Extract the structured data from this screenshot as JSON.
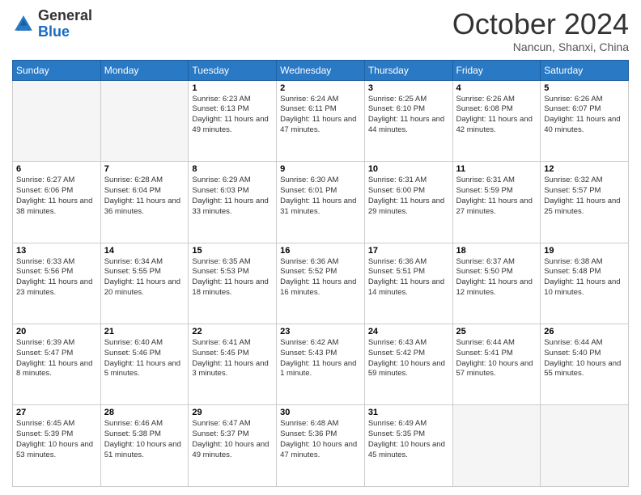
{
  "logo": {
    "general": "General",
    "blue": "Blue"
  },
  "header": {
    "month": "October 2024",
    "location": "Nancun, Shanxi, China"
  },
  "weekdays": [
    "Sunday",
    "Monday",
    "Tuesday",
    "Wednesday",
    "Thursday",
    "Friday",
    "Saturday"
  ],
  "weeks": [
    [
      {
        "day": "",
        "sunrise": "",
        "sunset": "",
        "daylight": ""
      },
      {
        "day": "",
        "sunrise": "",
        "sunset": "",
        "daylight": ""
      },
      {
        "day": "1",
        "sunrise": "Sunrise: 6:23 AM",
        "sunset": "Sunset: 6:13 PM",
        "daylight": "Daylight: 11 hours and 49 minutes."
      },
      {
        "day": "2",
        "sunrise": "Sunrise: 6:24 AM",
        "sunset": "Sunset: 6:11 PM",
        "daylight": "Daylight: 11 hours and 47 minutes."
      },
      {
        "day": "3",
        "sunrise": "Sunrise: 6:25 AM",
        "sunset": "Sunset: 6:10 PM",
        "daylight": "Daylight: 11 hours and 44 minutes."
      },
      {
        "day": "4",
        "sunrise": "Sunrise: 6:26 AM",
        "sunset": "Sunset: 6:08 PM",
        "daylight": "Daylight: 11 hours and 42 minutes."
      },
      {
        "day": "5",
        "sunrise": "Sunrise: 6:26 AM",
        "sunset": "Sunset: 6:07 PM",
        "daylight": "Daylight: 11 hours and 40 minutes."
      }
    ],
    [
      {
        "day": "6",
        "sunrise": "Sunrise: 6:27 AM",
        "sunset": "Sunset: 6:06 PM",
        "daylight": "Daylight: 11 hours and 38 minutes."
      },
      {
        "day": "7",
        "sunrise": "Sunrise: 6:28 AM",
        "sunset": "Sunset: 6:04 PM",
        "daylight": "Daylight: 11 hours and 36 minutes."
      },
      {
        "day": "8",
        "sunrise": "Sunrise: 6:29 AM",
        "sunset": "Sunset: 6:03 PM",
        "daylight": "Daylight: 11 hours and 33 minutes."
      },
      {
        "day": "9",
        "sunrise": "Sunrise: 6:30 AM",
        "sunset": "Sunset: 6:01 PM",
        "daylight": "Daylight: 11 hours and 31 minutes."
      },
      {
        "day": "10",
        "sunrise": "Sunrise: 6:31 AM",
        "sunset": "Sunset: 6:00 PM",
        "daylight": "Daylight: 11 hours and 29 minutes."
      },
      {
        "day": "11",
        "sunrise": "Sunrise: 6:31 AM",
        "sunset": "Sunset: 5:59 PM",
        "daylight": "Daylight: 11 hours and 27 minutes."
      },
      {
        "day": "12",
        "sunrise": "Sunrise: 6:32 AM",
        "sunset": "Sunset: 5:57 PM",
        "daylight": "Daylight: 11 hours and 25 minutes."
      }
    ],
    [
      {
        "day": "13",
        "sunrise": "Sunrise: 6:33 AM",
        "sunset": "Sunset: 5:56 PM",
        "daylight": "Daylight: 11 hours and 23 minutes."
      },
      {
        "day": "14",
        "sunrise": "Sunrise: 6:34 AM",
        "sunset": "Sunset: 5:55 PM",
        "daylight": "Daylight: 11 hours and 20 minutes."
      },
      {
        "day": "15",
        "sunrise": "Sunrise: 6:35 AM",
        "sunset": "Sunset: 5:53 PM",
        "daylight": "Daylight: 11 hours and 18 minutes."
      },
      {
        "day": "16",
        "sunrise": "Sunrise: 6:36 AM",
        "sunset": "Sunset: 5:52 PM",
        "daylight": "Daylight: 11 hours and 16 minutes."
      },
      {
        "day": "17",
        "sunrise": "Sunrise: 6:36 AM",
        "sunset": "Sunset: 5:51 PM",
        "daylight": "Daylight: 11 hours and 14 minutes."
      },
      {
        "day": "18",
        "sunrise": "Sunrise: 6:37 AM",
        "sunset": "Sunset: 5:50 PM",
        "daylight": "Daylight: 11 hours and 12 minutes."
      },
      {
        "day": "19",
        "sunrise": "Sunrise: 6:38 AM",
        "sunset": "Sunset: 5:48 PM",
        "daylight": "Daylight: 11 hours and 10 minutes."
      }
    ],
    [
      {
        "day": "20",
        "sunrise": "Sunrise: 6:39 AM",
        "sunset": "Sunset: 5:47 PM",
        "daylight": "Daylight: 11 hours and 8 minutes."
      },
      {
        "day": "21",
        "sunrise": "Sunrise: 6:40 AM",
        "sunset": "Sunset: 5:46 PM",
        "daylight": "Daylight: 11 hours and 5 minutes."
      },
      {
        "day": "22",
        "sunrise": "Sunrise: 6:41 AM",
        "sunset": "Sunset: 5:45 PM",
        "daylight": "Daylight: 11 hours and 3 minutes."
      },
      {
        "day": "23",
        "sunrise": "Sunrise: 6:42 AM",
        "sunset": "Sunset: 5:43 PM",
        "daylight": "Daylight: 11 hours and 1 minute."
      },
      {
        "day": "24",
        "sunrise": "Sunrise: 6:43 AM",
        "sunset": "Sunset: 5:42 PM",
        "daylight": "Daylight: 10 hours and 59 minutes."
      },
      {
        "day": "25",
        "sunrise": "Sunrise: 6:44 AM",
        "sunset": "Sunset: 5:41 PM",
        "daylight": "Daylight: 10 hours and 57 minutes."
      },
      {
        "day": "26",
        "sunrise": "Sunrise: 6:44 AM",
        "sunset": "Sunset: 5:40 PM",
        "daylight": "Daylight: 10 hours and 55 minutes."
      }
    ],
    [
      {
        "day": "27",
        "sunrise": "Sunrise: 6:45 AM",
        "sunset": "Sunset: 5:39 PM",
        "daylight": "Daylight: 10 hours and 53 minutes."
      },
      {
        "day": "28",
        "sunrise": "Sunrise: 6:46 AM",
        "sunset": "Sunset: 5:38 PM",
        "daylight": "Daylight: 10 hours and 51 minutes."
      },
      {
        "day": "29",
        "sunrise": "Sunrise: 6:47 AM",
        "sunset": "Sunset: 5:37 PM",
        "daylight": "Daylight: 10 hours and 49 minutes."
      },
      {
        "day": "30",
        "sunrise": "Sunrise: 6:48 AM",
        "sunset": "Sunset: 5:36 PM",
        "daylight": "Daylight: 10 hours and 47 minutes."
      },
      {
        "day": "31",
        "sunrise": "Sunrise: 6:49 AM",
        "sunset": "Sunset: 5:35 PM",
        "daylight": "Daylight: 10 hours and 45 minutes."
      },
      {
        "day": "",
        "sunrise": "",
        "sunset": "",
        "daylight": ""
      },
      {
        "day": "",
        "sunrise": "",
        "sunset": "",
        "daylight": ""
      }
    ]
  ]
}
